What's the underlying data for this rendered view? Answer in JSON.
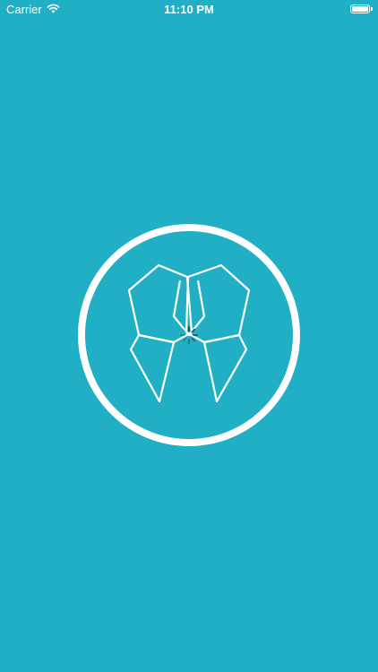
{
  "status_bar": {
    "carrier": "Carrier",
    "wifi_icon": "wifi-icon",
    "time": "11:10 PM",
    "battery_icon": "battery-icon",
    "battery_level": 1.0
  },
  "splash": {
    "logo_icon": "tooth-logo-icon",
    "loading_indicator": "activity-spinner-icon"
  },
  "colors": {
    "background": "#20AFC5",
    "foreground": "#FFFFFF",
    "spinner": "#2A4C59"
  }
}
